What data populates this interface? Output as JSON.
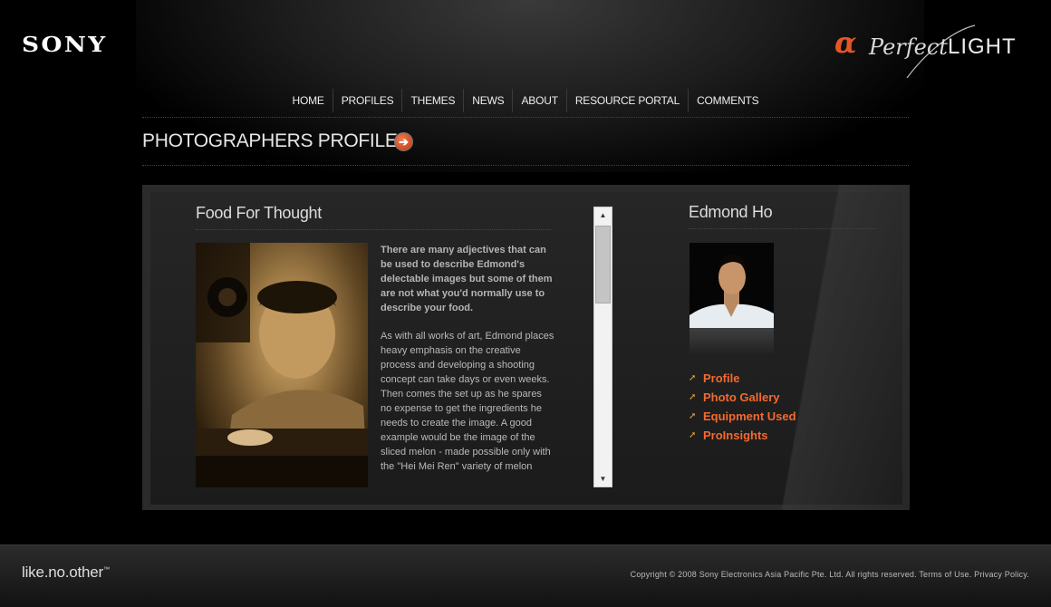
{
  "header": {
    "sony_logo": "SONY",
    "brand": {
      "alpha": "α",
      "perfect": "Perfect",
      "light": "LIGHT",
      "accent_color": "#e2562a"
    }
  },
  "nav": {
    "items": [
      "HOME",
      "PROFILES",
      "THEMES",
      "NEWS",
      "ABOUT",
      "RESOURCE PORTAL",
      "COMMENTS"
    ]
  },
  "section": {
    "title": "PHOTOGRAPHERS PROFILE",
    "arrow_icon": "arrow-circle-right-icon"
  },
  "article": {
    "title": "Food For Thought",
    "lead": "There are many adjectives that can be used to describe Edmond's delectable images but some of them are not what you'd normally use to describe your food.",
    "body": "As with all works of art, Edmond places heavy emphasis on the creative process and developing a shooting concept can take days or even weeks. Then comes the set up as he spares no expense to get the ingredients he needs to create the image. A good example would be the image of the sliced melon - made possible only with the \"Hei Mei Ren\" variety of melon"
  },
  "profile": {
    "name": "Edmond Ho",
    "links": [
      "Profile",
      "Photo Gallery",
      "Equipment Used",
      "ProInsights"
    ],
    "link_color": "#f26a30"
  },
  "footer": {
    "slogan": "like.no.other",
    "slogan_tm": "™",
    "copyright": "Copyright © 2008 Sony Electronics Asia Pacific Pte. Ltd. All rights reserved. Terms of Use. Privacy Policy."
  }
}
